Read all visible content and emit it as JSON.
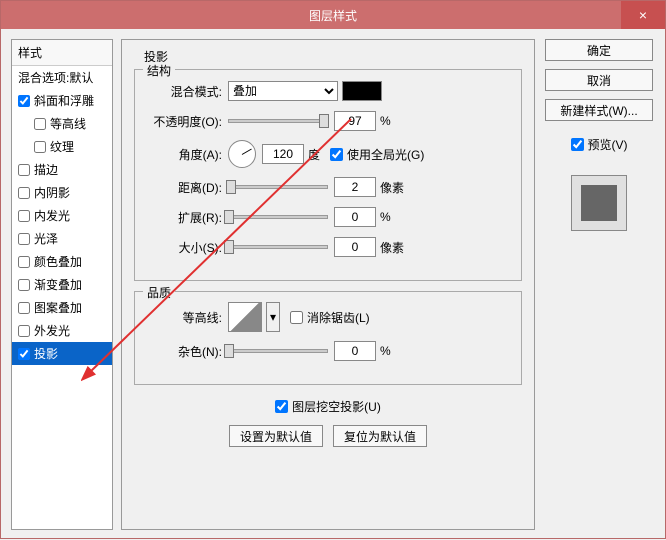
{
  "window": {
    "title": "图层样式",
    "close": "×"
  },
  "sidebar": {
    "header": "样式",
    "blend_defaults": "混合选项:默认",
    "items": [
      {
        "label": "斜面和浮雕",
        "checked": true,
        "indent": false
      },
      {
        "label": "等高线",
        "checked": false,
        "indent": true
      },
      {
        "label": "纹理",
        "checked": false,
        "indent": true
      },
      {
        "label": "描边",
        "checked": false,
        "indent": false
      },
      {
        "label": "内阴影",
        "checked": false,
        "indent": false
      },
      {
        "label": "内发光",
        "checked": false,
        "indent": false
      },
      {
        "label": "光泽",
        "checked": false,
        "indent": false
      },
      {
        "label": "颜色叠加",
        "checked": false,
        "indent": false
      },
      {
        "label": "渐变叠加",
        "checked": false,
        "indent": false
      },
      {
        "label": "图案叠加",
        "checked": false,
        "indent": false
      },
      {
        "label": "外发光",
        "checked": false,
        "indent": false
      },
      {
        "label": "投影",
        "checked": true,
        "indent": false,
        "selected": true
      }
    ]
  },
  "main": {
    "title": "投影",
    "structure": {
      "title": "结构",
      "blend_mode_label": "混合模式:",
      "blend_mode_value": "叠加",
      "opacity_label": "不透明度(O):",
      "opacity_value": "97",
      "opacity_unit": "%",
      "angle_label": "角度(A):",
      "angle_value": "120",
      "angle_unit": "度",
      "global_light_label": "使用全局光(G)",
      "global_light_checked": true,
      "distance_label": "距离(D):",
      "distance_value": "2",
      "distance_unit": "像素",
      "spread_label": "扩展(R):",
      "spread_value": "0",
      "spread_unit": "%",
      "size_label": "大小(S):",
      "size_value": "0",
      "size_unit": "像素"
    },
    "quality": {
      "title": "品质",
      "contour_label": "等高线:",
      "antialias_label": "消除锯齿(L)",
      "antialias_checked": false,
      "noise_label": "杂色(N):",
      "noise_value": "0",
      "noise_unit": "%"
    },
    "knockout_label": "图层挖空投影(U)",
    "knockout_checked": true,
    "set_default": "设置为默认值",
    "reset_default": "复位为默认值"
  },
  "right": {
    "ok": "确定",
    "cancel": "取消",
    "new_style": "新建样式(W)...",
    "preview_label": "预览(V)",
    "preview_checked": true
  }
}
